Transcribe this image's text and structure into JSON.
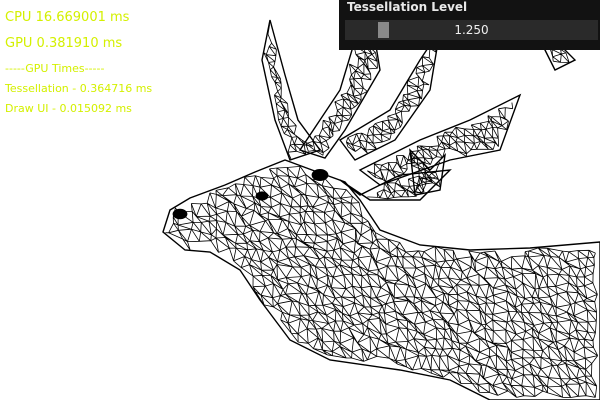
{
  "stats": {
    "cpu": "CPU 16.669001 ms",
    "gpu": "GPU 0.381910 ms",
    "gpu_times_header": "-----GPU Times-----",
    "tessellation_time": "Tessellation -  0.364716 ms",
    "draw_ui_time": "Draw UI -  0.015092 ms"
  },
  "panel": {
    "title": "Tessellation Level",
    "slider_value_text": "1.250",
    "slider_fraction": 0.125
  },
  "colors": {
    "stat_text": "#d4f000",
    "panel_bg": "#121212",
    "slider_track": "#2a2a2a",
    "slider_grab": "#8a8a8a",
    "mesh": "#000000"
  },
  "scene": {
    "subject": "wireframe-deer-mesh"
  }
}
